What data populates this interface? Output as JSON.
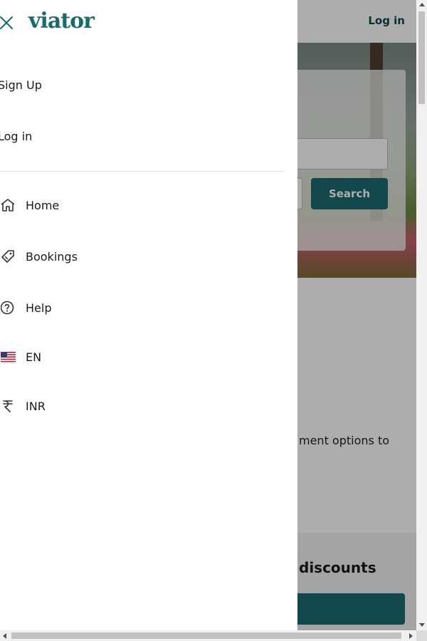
{
  "drawer": {
    "brand": "viator",
    "close_icon": "close-icon",
    "auth": {
      "sign_up": "Sign Up",
      "log_in": "Log in"
    },
    "nav": [
      {
        "label": "Home",
        "icon": "home-icon"
      },
      {
        "label": "Bookings",
        "icon": "tag-icon"
      },
      {
        "label": "Help",
        "icon": "help-circle-icon"
      },
      {
        "label": "EN",
        "icon": "us-flag-icon"
      },
      {
        "label": "INR",
        "icon": "rupee-icon"
      }
    ]
  },
  "background": {
    "header_login": "Log in",
    "search_button": "Search",
    "partial_text": "ment options to",
    "partial_heading": "discounts"
  },
  "colors": {
    "brand": "#186b6d",
    "primary_button": "#1b6b70",
    "overlay": "rgba(0,0,0,0.32)"
  }
}
